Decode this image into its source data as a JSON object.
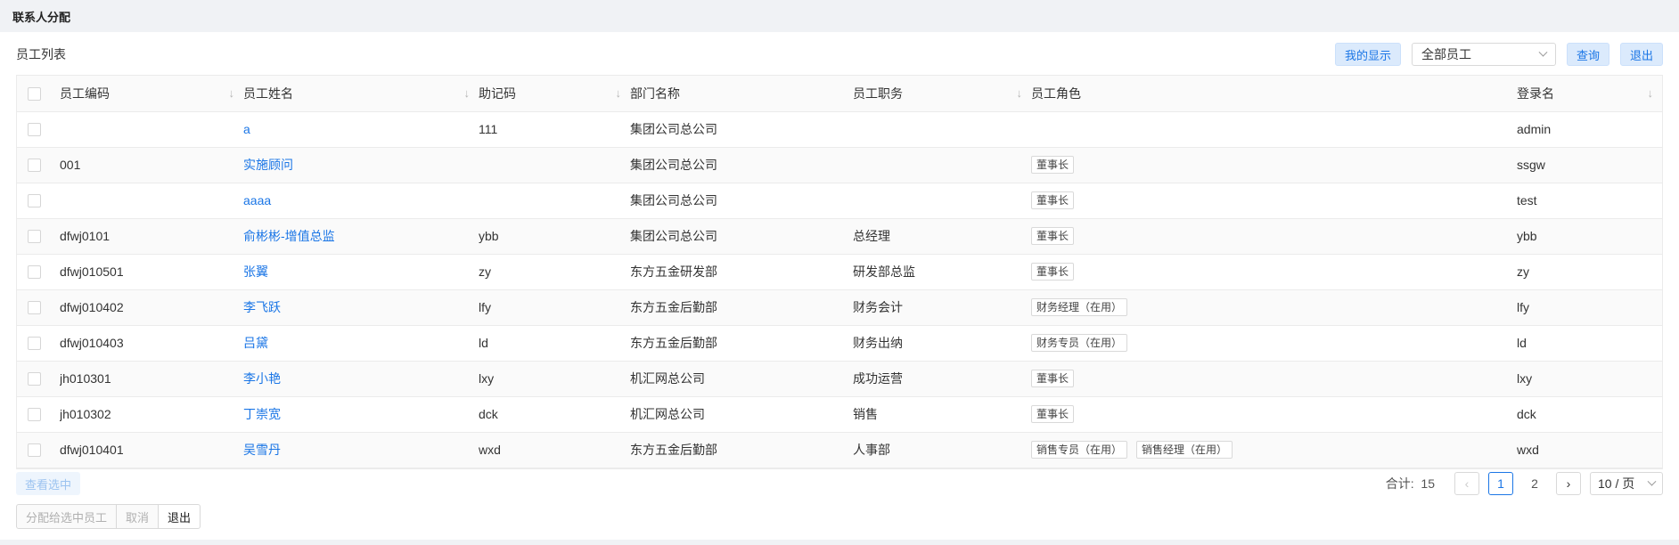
{
  "page": {
    "title": "联系人分配"
  },
  "panel": {
    "title": "员工列表",
    "my_display_label": "我的显示",
    "employee_filter": "全部员工",
    "query_label": "查询",
    "exit_label": "退出"
  },
  "table": {
    "columns": [
      "员工编码",
      "员工姓名",
      "助记码",
      "部门名称",
      "员工职务",
      "员工角色",
      "登录名"
    ],
    "rows": [
      {
        "code": "",
        "name": "a",
        "mnemonic": "111",
        "dept": "集团公司总公司",
        "title": "",
        "roles": [],
        "login": "admin"
      },
      {
        "code": "001",
        "name": "实施顾问",
        "mnemonic": "",
        "dept": "集团公司总公司",
        "title": "",
        "roles": [
          "董事长"
        ],
        "login": "ssgw"
      },
      {
        "code": "",
        "name": "aaaa",
        "mnemonic": "",
        "dept": "集团公司总公司",
        "title": "",
        "roles": [
          "董事长"
        ],
        "login": "test"
      },
      {
        "code": "dfwj0101",
        "name": "俞彬彬-增值总监",
        "mnemonic": "ybb",
        "dept": "集团公司总公司",
        "title": "总经理",
        "roles": [
          "董事长"
        ],
        "login": "ybb"
      },
      {
        "code": "dfwj010501",
        "name": "张翼",
        "mnemonic": "zy",
        "dept": "东方五金研发部",
        "title": "研发部总监",
        "roles": [
          "董事长"
        ],
        "login": "zy"
      },
      {
        "code": "dfwj010402",
        "name": "李飞跃",
        "mnemonic": "lfy",
        "dept": "东方五金后勤部",
        "title": "财务会计",
        "roles": [
          "财务经理（在用）"
        ],
        "login": "lfy"
      },
      {
        "code": "dfwj010403",
        "name": "吕黛",
        "mnemonic": "ld",
        "dept": "东方五金后勤部",
        "title": "财务出纳",
        "roles": [
          "财务专员（在用）"
        ],
        "login": "ld"
      },
      {
        "code": "jh010301",
        "name": "李小艳",
        "mnemonic": "lxy",
        "dept": "机汇网总公司",
        "title": "成功运营",
        "roles": [
          "董事长"
        ],
        "login": "lxy"
      },
      {
        "code": "jh010302",
        "name": "丁崇宽",
        "mnemonic": "dck",
        "dept": "机汇网总公司",
        "title": "销售",
        "roles": [
          "董事长"
        ],
        "login": "dck"
      },
      {
        "code": "dfwj010401",
        "name": "吴雪丹",
        "mnemonic": "wxd",
        "dept": "东方五金后勤部",
        "title": "人事部",
        "roles": [
          "销售专员（在用）",
          "销售经理（在用）"
        ],
        "login": "wxd"
      }
    ]
  },
  "footer": {
    "view_selected_label": "查看选中",
    "total_label": "合计:",
    "total_value": "15",
    "pages": [
      "1",
      "2"
    ],
    "current_page": "1",
    "page_size": "10 / 页"
  },
  "actions": {
    "assign_label": "分配给选中员工",
    "cancel_label": "取消",
    "exit_label": "退出"
  },
  "colors": {
    "accent": "#1b76e6",
    "accent_light": "#dbeafc"
  },
  "icons": [
    "sort-arrow-icon",
    "chevron-down-icon",
    "chevron-left-icon",
    "chevron-right-icon",
    "checkbox-icon"
  ]
}
